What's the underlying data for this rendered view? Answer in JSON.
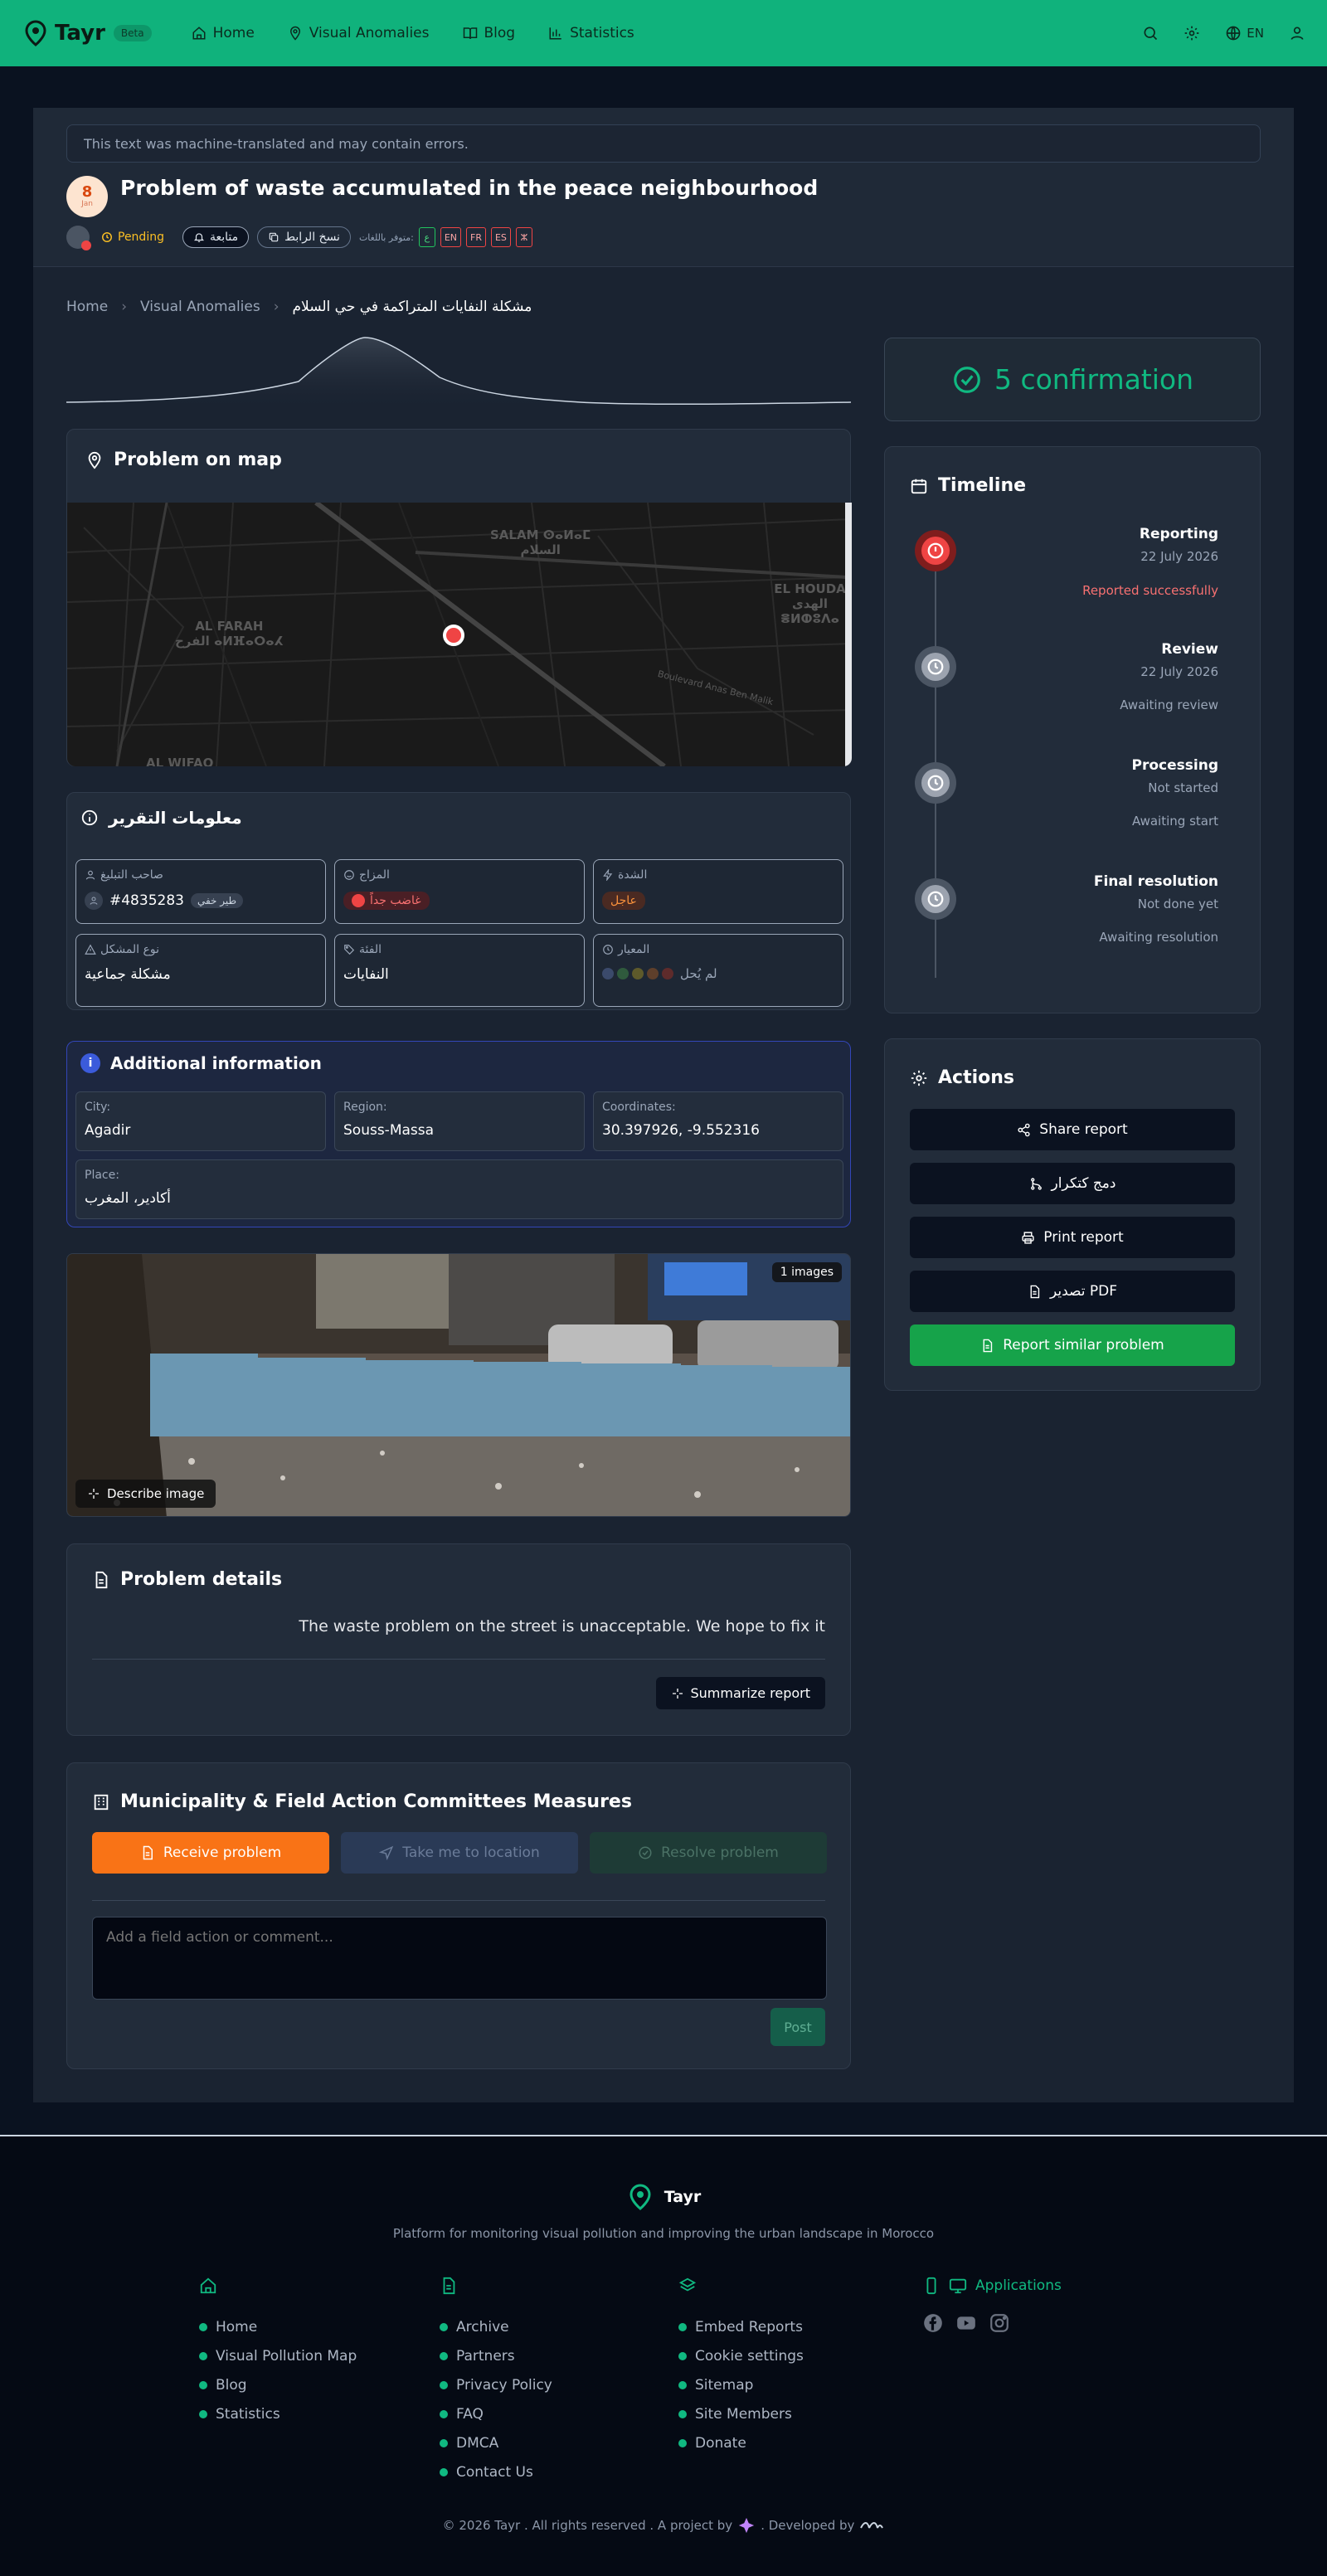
{
  "colors": {
    "brand": "#10b27c",
    "danger": "#ef4444",
    "accent_orange": "#f97316",
    "success": "#16a34a"
  },
  "nav": {
    "brand": "Tayr",
    "beta": "Beta",
    "items": [
      {
        "label": "Home",
        "icon": "home-icon"
      },
      {
        "label": "Visual Anomalies",
        "icon": "map-pin-icon"
      },
      {
        "label": "Blog",
        "icon": "book-icon"
      },
      {
        "label": "Statistics",
        "icon": "bar-chart-icon"
      }
    ],
    "lang": "EN"
  },
  "report": {
    "mt_notice": "This text was machine-translated and may contain errors.",
    "date_day": "8",
    "date_month": "Jan",
    "title": "Problem of waste accumulated in the peace neighbourhood",
    "status": "Pending",
    "follow": "متابعة",
    "copy_link": "نسخ الرابط",
    "available_in": "متوفر باللغات:",
    "languages": [
      "ع",
      "EN",
      "FR",
      "ES",
      "ⵣ"
    ]
  },
  "breadcrumb": {
    "home": "Home",
    "section": "Visual Anomalies",
    "current": "مشكلة النفايات المتراكمة في حي السلام"
  },
  "map": {
    "title": "Problem on map",
    "labels": [
      "SALAM ⵙⴰⵍⴰⵎ\nالسلام",
      "AL FARAH\nالفرح ⴰⵍⴼⴰⵔⴰⵃ",
      "EL HOUDA\nالهدى ⴻⵍⵀⵓⴷⴰ",
      "Boulevard Anas Ben Malik",
      "AL WIFAQ"
    ]
  },
  "info": {
    "title": "معلومات التقرير",
    "owner_label": "صاحب التبليغ",
    "owner_value": "#4835283",
    "owner_tag": "طير خفي",
    "mood_label": "المزاج",
    "mood_value": "غاضب جداً",
    "severity_label": "الشدة",
    "severity_value": "عاجل",
    "type_label": "نوع المشكل",
    "type_value": "مشكلة جماعية",
    "category_label": "الفئة",
    "category_value": "النفايات",
    "rating_label": "المعيار",
    "rating_value": "لم يُحل"
  },
  "additional": {
    "title": "Additional information",
    "city_label": "City:",
    "city": "Agadir",
    "region_label": "Region:",
    "region": "Souss-Massa",
    "coords_label": "Coordinates:",
    "coords": "30.397926, -9.552316",
    "place_label": "Place:",
    "place": "أكادير، المغرب"
  },
  "photo": {
    "count": "1 images",
    "describe": "Describe image"
  },
  "details": {
    "title": "Problem details",
    "text": "The waste problem on the street is unacceptable. We hope to fix it",
    "summarize": "Summarize report"
  },
  "municipality": {
    "title": "Municipality & Field Action Committees Measures",
    "receive": "Receive problem",
    "take": "Take me to location",
    "resolve": "Resolve problem",
    "comment_placeholder": "Add a field action or comment...",
    "post": "Post"
  },
  "confirmation": "5 confirmation",
  "timeline": {
    "title": "Timeline",
    "steps": [
      {
        "title": "Reporting",
        "date": "22 July 2026",
        "status": "Reported successfully"
      },
      {
        "title": "Review",
        "date": "22 July 2026",
        "status": "Awaiting review"
      },
      {
        "title": "Processing",
        "date": "Not started",
        "status": "Awaiting start"
      },
      {
        "title": "Final resolution",
        "date": "Not done yet",
        "status": "Awaiting resolution"
      }
    ]
  },
  "actions": {
    "title": "Actions",
    "share": "Share report",
    "merge": "دمج كتكرار",
    "print": "Print report",
    "pdf": "تصدير PDF",
    "similar": "Report similar problem"
  },
  "footer": {
    "brand": "Tayr",
    "tagline": "Platform for monitoring visual pollution and improving the urban landscape in Morocco",
    "col1": [
      "Home",
      "Visual Pollution Map",
      "Blog",
      "Statistics"
    ],
    "col2": [
      "Archive",
      "Partners",
      "Privacy Policy",
      "FAQ",
      "DMCA",
      "Contact Us"
    ],
    "col3": [
      "Embed Reports",
      "Cookie settings",
      "Sitemap",
      "Site Members",
      "Donate"
    ],
    "apps": "Applications",
    "copyright": "© 2026 Tayr . All rights reserved . A project by",
    "developed": ". Developed by"
  }
}
